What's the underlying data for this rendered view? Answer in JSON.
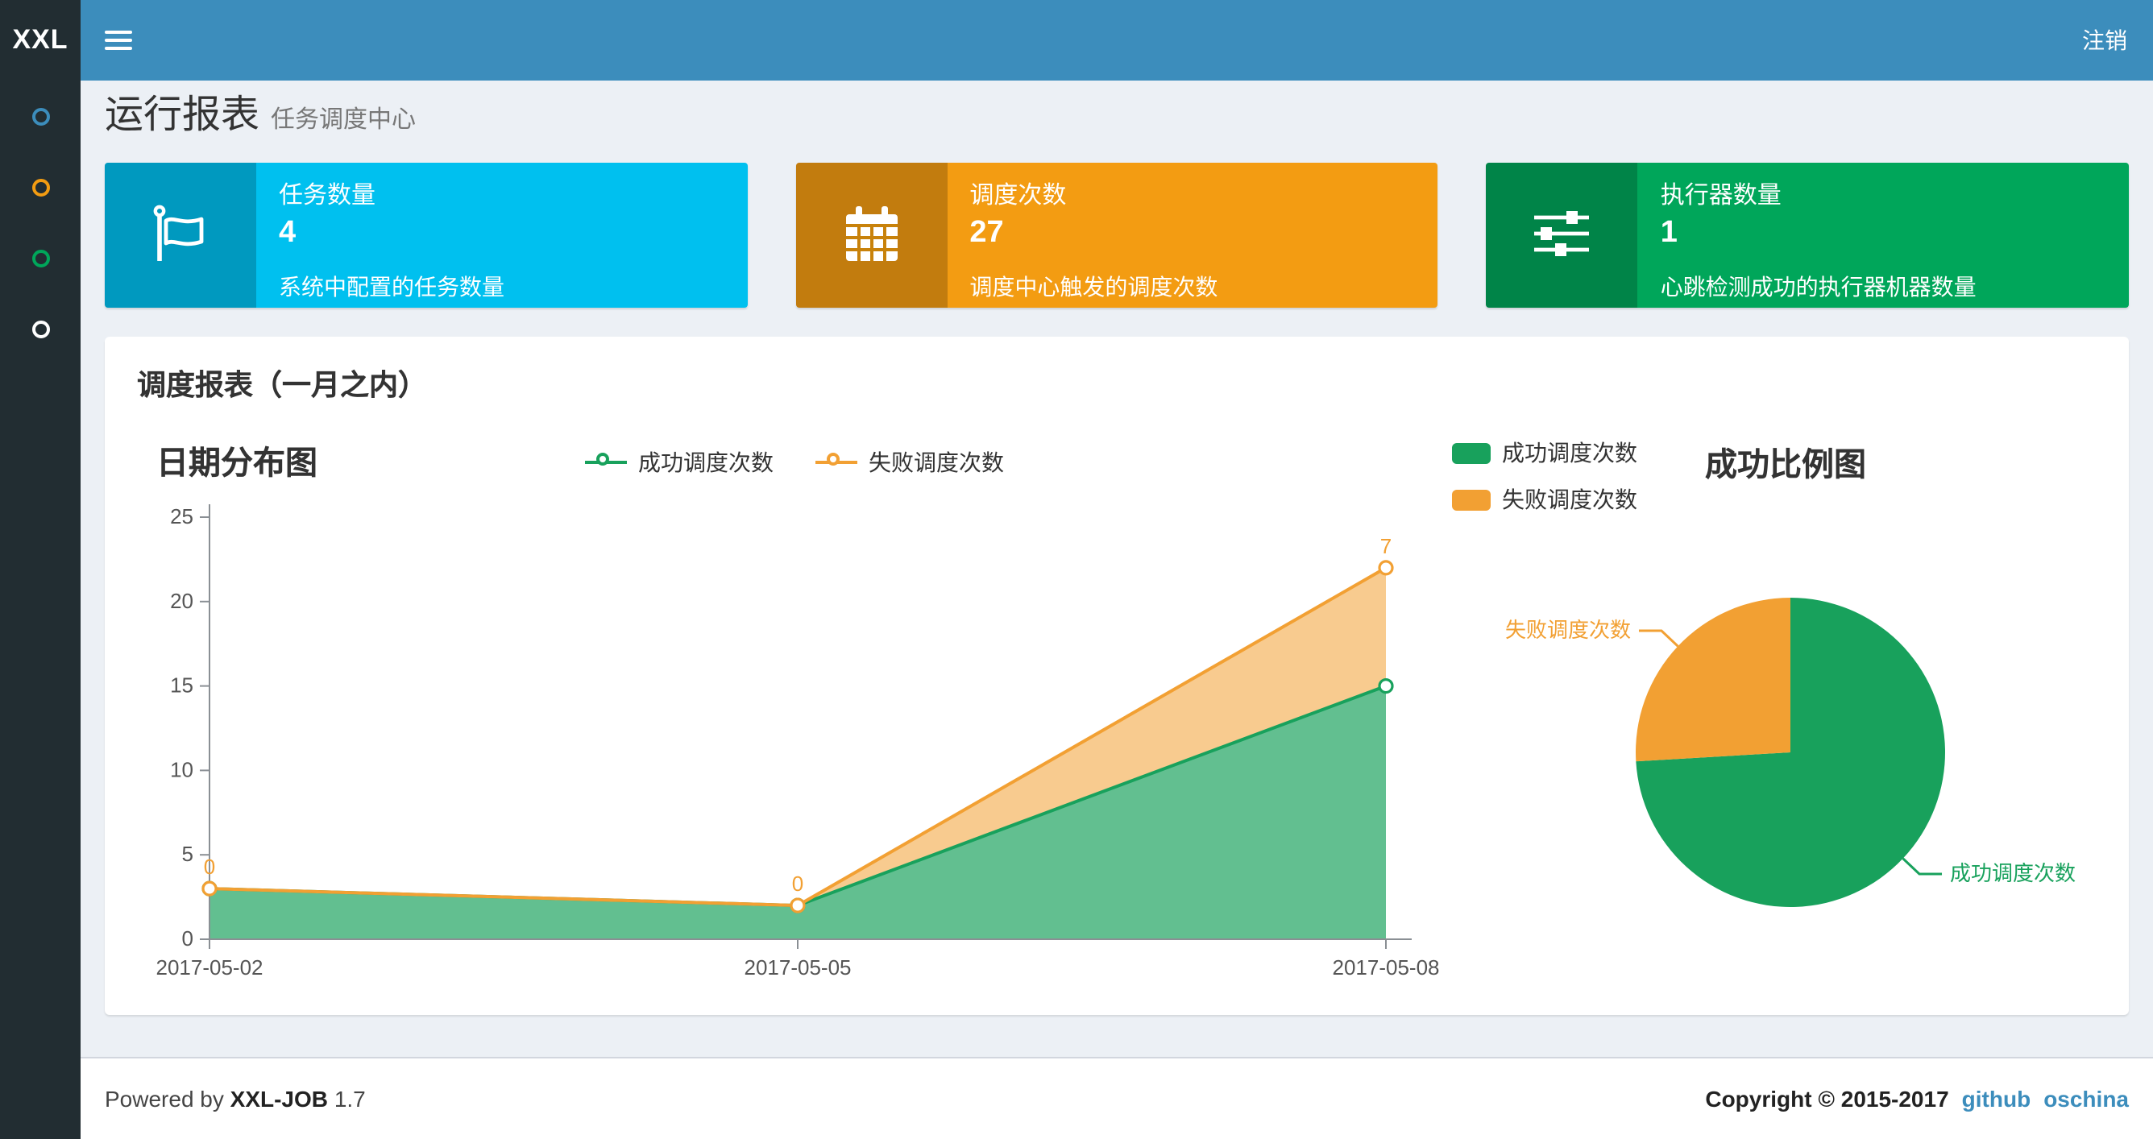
{
  "navbar": {
    "logo": "XXL",
    "logout_label": "注销"
  },
  "sidebar": {
    "items": [
      {
        "icon": "circle-outline-icon",
        "color": "#3c8dbc"
      },
      {
        "icon": "circle-outline-icon",
        "color": "#f39c12"
      },
      {
        "icon": "circle-outline-icon",
        "color": "#00a65a"
      },
      {
        "icon": "circle-outline-icon",
        "color": "#ffffff"
      }
    ]
  },
  "header": {
    "title": "运行报表",
    "subtitle": "任务调度中心"
  },
  "info_boxes": [
    {
      "label": "任务数量",
      "value": "4",
      "desc": "系统中配置的任务数量",
      "color": "#00c0ef",
      "icon": "flag-icon"
    },
    {
      "label": "调度次数",
      "value": "27",
      "desc": "调度中心触发的调度次数",
      "color": "#f39c12",
      "icon": "calendar-icon"
    },
    {
      "label": "执行器数量",
      "value": "1",
      "desc": "心跳检测成功的执行器机器数量",
      "color": "#00a65a",
      "icon": "sliders-icon"
    }
  ],
  "panel": {
    "title": "调度报表（一月之内）"
  },
  "chart_data": [
    {
      "type": "area",
      "title": "日期分布图",
      "stacked": true,
      "categories": [
        "2017-05-02",
        "2017-05-05",
        "2017-05-08"
      ],
      "series": [
        {
          "name": "成功调度次数",
          "color": "#18a15c",
          "values": [
            3,
            2,
            15
          ]
        },
        {
          "name": "失败调度次数",
          "color": "#f2a033",
          "values": [
            0,
            0,
            7
          ],
          "labels_shown": true
        }
      ],
      "ylim": [
        0,
        25
      ],
      "yticks": [
        0,
        5,
        10,
        15,
        20,
        25
      ],
      "xlabel": "",
      "ylabel": "",
      "legend_position": "top-center",
      "grid": false
    },
    {
      "type": "pie",
      "title": "成功比例图",
      "slices": [
        {
          "name": "成功调度次数",
          "value": 20,
          "color": "#18a15c"
        },
        {
          "name": "失败调度次数",
          "value": 7,
          "color": "#f2a033"
        }
      ],
      "legend_position": "top-left"
    }
  ],
  "footer": {
    "powered_prefix": "Powered by",
    "brand": "XXL-JOB",
    "version": "1.7",
    "copyright": "Copyright © 2015-2017",
    "links": [
      {
        "label": "github"
      },
      {
        "label": "oschina"
      }
    ]
  }
}
